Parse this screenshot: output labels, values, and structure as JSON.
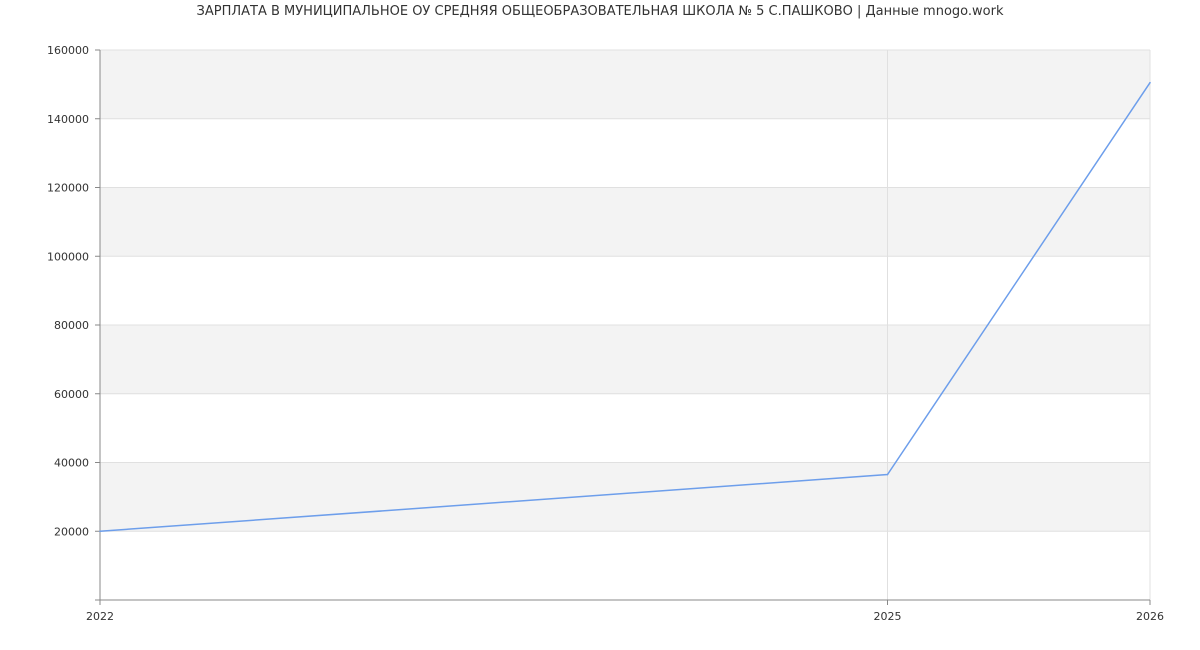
{
  "chart_data": {
    "type": "line",
    "title": "ЗАРПЛАТА В МУНИЦИПАЛЬНОЕ ОУ СРЕДНЯЯ ОБЩЕОБРАЗОВАТЕЛЬНАЯ ШКОЛА № 5 С.ПАШКОВО | Данные mnogo.work",
    "xlabel": "",
    "ylabel": "",
    "x": [
      2022,
      2025,
      2026
    ],
    "series": [
      {
        "values": [
          20000,
          36500,
          150500
        ]
      }
    ],
    "xlim": [
      2022,
      2026
    ],
    "ylim": [
      0,
      160000
    ],
    "x_ticks": [
      "2022",
      "2025",
      "2026"
    ],
    "y_ticks": [
      20000,
      40000,
      60000,
      80000,
      100000,
      120000,
      140000,
      160000
    ],
    "y_tick_labels": [
      "20000",
      "40000",
      "60000",
      "80000",
      "100000",
      "120000",
      "140000",
      "160000"
    ],
    "grid": true,
    "alternating_bands": true,
    "colors": {
      "line": "#6d9eeb",
      "band": "#f3f3f3",
      "grid": "#e0e0e0",
      "axis": "#888888",
      "text": "#333333"
    }
  }
}
